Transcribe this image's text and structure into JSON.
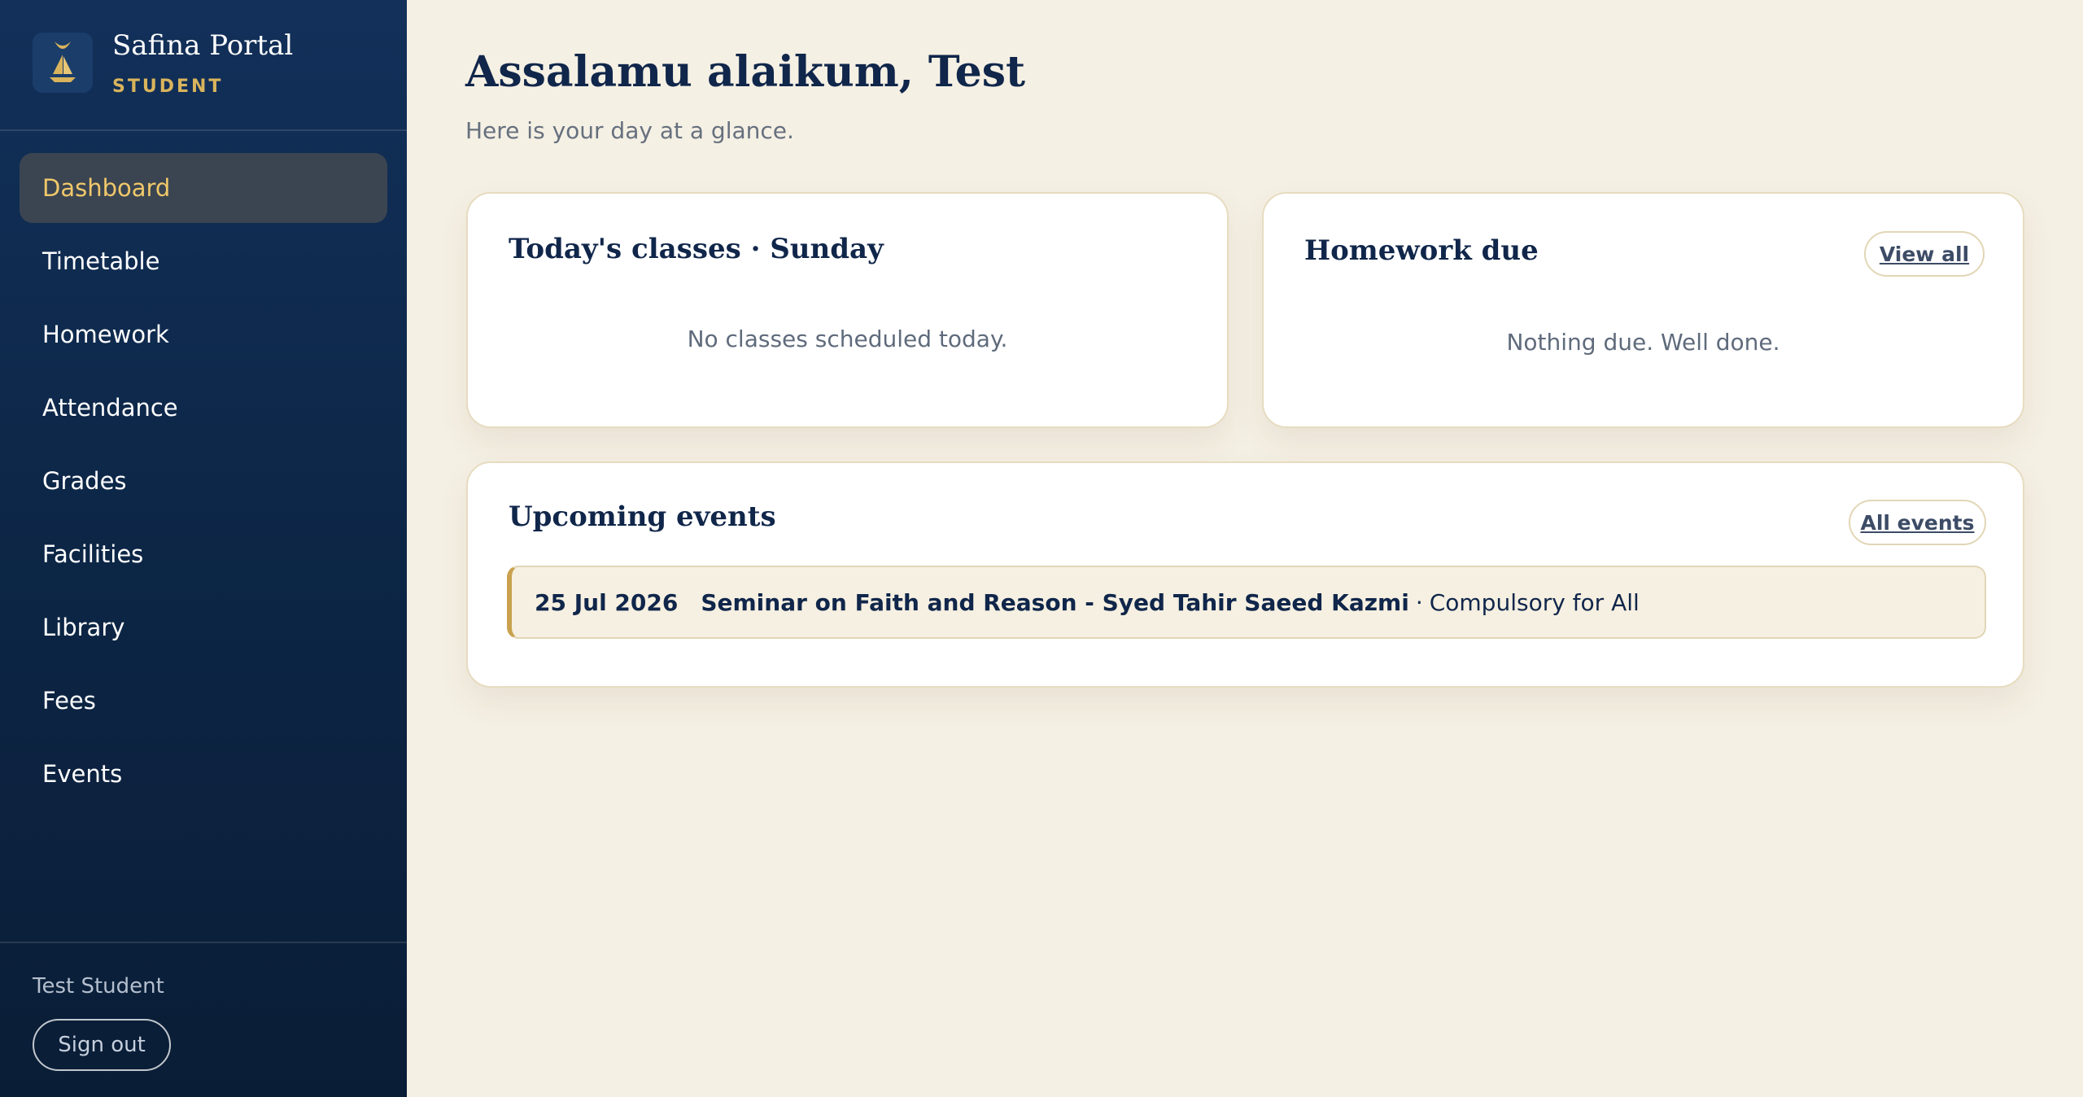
{
  "brand": {
    "name": "Safina Portal",
    "role": "STUDENT",
    "logo_icon": "sailboat-crescent-icon",
    "accent_color": "#d9b45c"
  },
  "nav": {
    "items": [
      {
        "label": "Dashboard",
        "active": true
      },
      {
        "label": "Timetable",
        "active": false
      },
      {
        "label": "Homework",
        "active": false
      },
      {
        "label": "Attendance",
        "active": false
      },
      {
        "label": "Grades",
        "active": false
      },
      {
        "label": "Facilities",
        "active": false
      },
      {
        "label": "Library",
        "active": false
      },
      {
        "label": "Fees",
        "active": false
      },
      {
        "label": "Events",
        "active": false
      }
    ]
  },
  "user": {
    "name": "Test Student",
    "signout_label": "Sign out"
  },
  "header": {
    "greeting": "Assalamu alaikum, Test",
    "subtitle": "Here is your day at a glance."
  },
  "classes_card": {
    "title": "Today's classes · Sunday",
    "empty_text": "No classes scheduled today."
  },
  "homework_card": {
    "title": "Homework due",
    "link_label": "View all",
    "empty_text": "Nothing due. Well done."
  },
  "events_card": {
    "title": "Upcoming events",
    "link_label": "All events",
    "items": [
      {
        "date": "25 Jul 2026",
        "title": "Seminar on Faith and Reason - Syed Tahir Saeed Kazmi",
        "separator": "·",
        "tag": "Compulsory for All"
      }
    ]
  }
}
